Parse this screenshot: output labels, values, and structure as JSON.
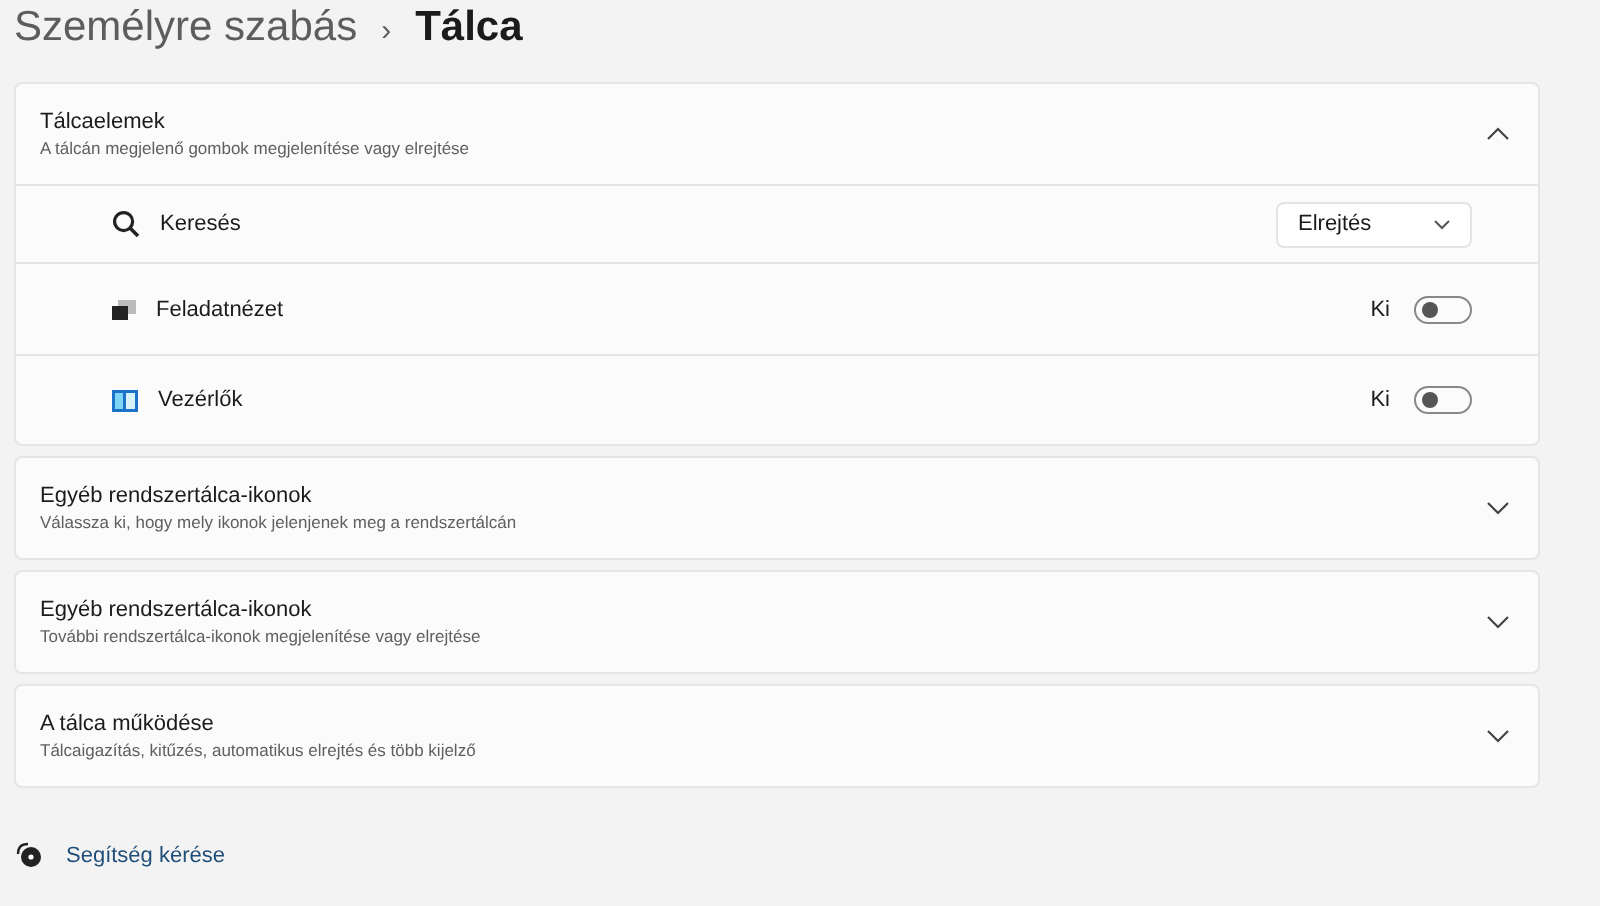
{
  "breadcrumb": {
    "parent": "Személyre szabás",
    "separator": "›",
    "current": "Tálca"
  },
  "sections": [
    {
      "title": "Tálcaelemek",
      "subtitle": "A tálcán megjelenő gombok megjelenítése vagy elrejtése",
      "expanded": true,
      "items": [
        {
          "kind": "dropdown",
          "label": "Keresés",
          "value": "Elrejtés"
        },
        {
          "kind": "toggle",
          "label": "Feladatnézet",
          "state_label": "Ki",
          "on": false
        },
        {
          "kind": "toggle",
          "label": "Vezérlők",
          "state_label": "Ki",
          "on": false
        }
      ]
    },
    {
      "title": "Egyéb rendszertálca-ikonok",
      "subtitle": "Válassza ki, hogy mely ikonok jelenjenek meg a rendszertálcán",
      "expanded": false
    },
    {
      "title": "Egyéb rendszertálca-ikonok",
      "subtitle": "További rendszertálca-ikonok megjelenítése vagy elrejtése",
      "expanded": false
    },
    {
      "title": "A tálca működése",
      "subtitle": "Tálcaigazítás, kitűzés, automatikus elrejtés és több kijelző",
      "expanded": false
    }
  ],
  "help_link": "Segítség kérése"
}
